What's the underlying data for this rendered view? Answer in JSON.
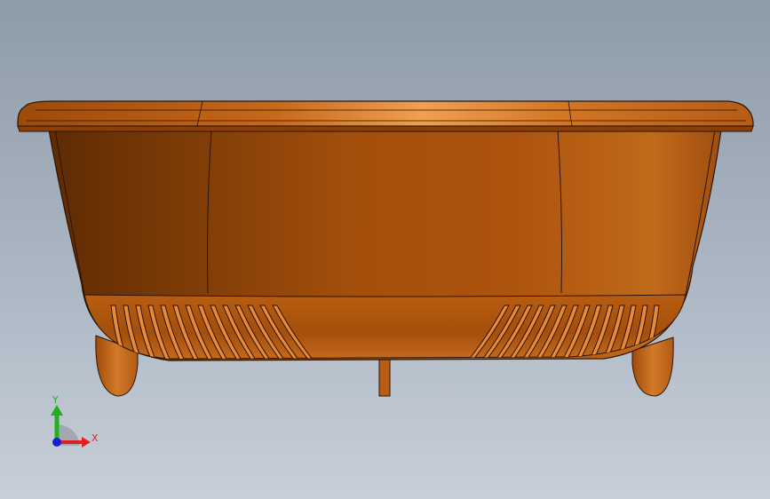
{
  "app": {
    "title": ""
  },
  "model": {
    "name": "basket",
    "body_color": "#b35a12",
    "rim_color": "#c0641a",
    "edge_color": "#2a1505"
  },
  "triad": {
    "x_label": "X",
    "y_label": "Y",
    "x_color": "#e02020",
    "y_color": "#20b020",
    "origin_color": "#1c1cd8"
  },
  "background": {
    "top": "#8e9ba9",
    "bottom": "#c7cfd8"
  }
}
